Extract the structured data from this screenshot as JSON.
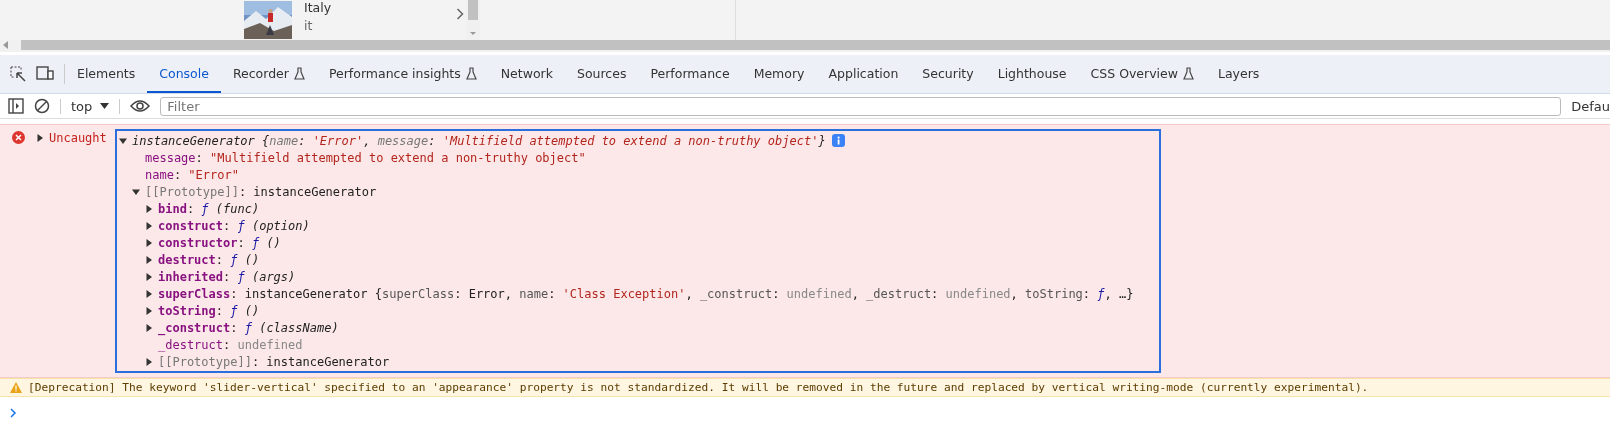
{
  "page_preview": {
    "kind": "picture",
    "title": "Italy",
    "subtitle": "it"
  },
  "tabs": [
    {
      "label": "Elements",
      "selected": false,
      "experimental": false
    },
    {
      "label": "Console",
      "selected": true,
      "experimental": false
    },
    {
      "label": "Recorder",
      "selected": false,
      "experimental": true
    },
    {
      "label": "Performance insights",
      "selected": false,
      "experimental": true
    },
    {
      "label": "Network",
      "selected": false,
      "experimental": false
    },
    {
      "label": "Sources",
      "selected": false,
      "experimental": false
    },
    {
      "label": "Performance",
      "selected": false,
      "experimental": false
    },
    {
      "label": "Memory",
      "selected": false,
      "experimental": false
    },
    {
      "label": "Application",
      "selected": false,
      "experimental": false
    },
    {
      "label": "Security",
      "selected": false,
      "experimental": false
    },
    {
      "label": "Lighthouse",
      "selected": false,
      "experimental": false
    },
    {
      "label": "CSS Overview",
      "selected": false,
      "experimental": true
    },
    {
      "label": "Layers",
      "selected": false,
      "experimental": false
    }
  ],
  "console_toolbar": {
    "context": "top",
    "filter_placeholder": "Filter",
    "levels_label": "Defau"
  },
  "messages": [
    {
      "kind": "error",
      "label": "Uncaught",
      "expanded": false,
      "object": {
        "kind": "node",
        "expanded": true,
        "selected": true,
        "info_badge": true,
        "segments": [
          {
            "text": "instanceGenerator ",
            "kind": "class"
          },
          {
            "text": "{",
            "kind": "preview"
          },
          {
            "text": "name",
            "kind": "preview_key"
          },
          {
            "text": ": ",
            "kind": "preview"
          },
          {
            "text": "'Error'",
            "kind": "preview_string"
          },
          {
            "text": ", ",
            "kind": "preview"
          },
          {
            "text": "message",
            "kind": "preview_key"
          },
          {
            "text": ": ",
            "kind": "preview"
          },
          {
            "text": "'Multifield attempted to extend a non-truthy object'",
            "kind": "preview_string"
          },
          {
            "text": "}",
            "kind": "preview"
          }
        ],
        "children": [
          {
            "kind": "leaf",
            "segments": [
              {
                "text": "message",
                "kind": "key"
              },
              {
                "text": ": ",
                "kind": "plain"
              },
              {
                "text": "\"Multifield attempted to extend a non-truthy object\"",
                "kind": "string"
              }
            ]
          },
          {
            "kind": "leaf",
            "segments": [
              {
                "text": "name",
                "kind": "key"
              },
              {
                "text": ": ",
                "kind": "plain"
              },
              {
                "text": "\"Error\"",
                "kind": "string"
              }
            ]
          },
          {
            "kind": "node",
            "expanded": true,
            "segments": [
              {
                "text": "[[Prototype]]",
                "kind": "internal"
              },
              {
                "text": ": instanceGenerator",
                "kind": "plain"
              }
            ],
            "children": [
              {
                "kind": "node",
                "expanded": false,
                "segments": [
                  {
                    "text": "bind",
                    "kind": "method"
                  },
                  {
                    "text": ": ",
                    "kind": "plain"
                  },
                  {
                    "text": "ƒ",
                    "kind": "func"
                  },
                  {
                    "text": " (func)",
                    "kind": "args"
                  }
                ]
              },
              {
                "kind": "node",
                "expanded": false,
                "segments": [
                  {
                    "text": "construct",
                    "kind": "method"
                  },
                  {
                    "text": ": ",
                    "kind": "plain"
                  },
                  {
                    "text": "ƒ",
                    "kind": "func"
                  },
                  {
                    "text": " (option)",
                    "kind": "args"
                  }
                ]
              },
              {
                "kind": "node",
                "expanded": false,
                "segments": [
                  {
                    "text": "constructor",
                    "kind": "method"
                  },
                  {
                    "text": ": ",
                    "kind": "plain"
                  },
                  {
                    "text": "ƒ",
                    "kind": "func"
                  },
                  {
                    "text": " ()",
                    "kind": "args"
                  }
                ]
              },
              {
                "kind": "node",
                "expanded": false,
                "segments": [
                  {
                    "text": "destruct",
                    "kind": "method"
                  },
                  {
                    "text": ": ",
                    "kind": "plain"
                  },
                  {
                    "text": "ƒ",
                    "kind": "func"
                  },
                  {
                    "text": " ()",
                    "kind": "args"
                  }
                ]
              },
              {
                "kind": "node",
                "expanded": false,
                "segments": [
                  {
                    "text": "inherited",
                    "kind": "method"
                  },
                  {
                    "text": ": ",
                    "kind": "plain"
                  },
                  {
                    "text": "ƒ",
                    "kind": "func"
                  },
                  {
                    "text": " (args)",
                    "kind": "args"
                  }
                ]
              },
              {
                "kind": "node",
                "expanded": false,
                "segments": [
                  {
                    "text": "superClass",
                    "kind": "method"
                  },
                  {
                    "text": ": instanceGenerator {",
                    "kind": "plain"
                  },
                  {
                    "text": "superClass",
                    "kind": "inner_key"
                  },
                  {
                    "text": ": Error, ",
                    "kind": "plain"
                  },
                  {
                    "text": "name",
                    "kind": "inner_key"
                  },
                  {
                    "text": ": ",
                    "kind": "plain"
                  },
                  {
                    "text": "'Class Exception'",
                    "kind": "string"
                  },
                  {
                    "text": ", ",
                    "kind": "plain"
                  },
                  {
                    "text": "_construct",
                    "kind": "inner_key"
                  },
                  {
                    "text": ": ",
                    "kind": "plain"
                  },
                  {
                    "text": "undefined",
                    "kind": "undefined"
                  },
                  {
                    "text": ", ",
                    "kind": "plain"
                  },
                  {
                    "text": "_destruct",
                    "kind": "inner_key"
                  },
                  {
                    "text": ": ",
                    "kind": "plain"
                  },
                  {
                    "text": "undefined",
                    "kind": "undefined"
                  },
                  {
                    "text": ", ",
                    "kind": "plain"
                  },
                  {
                    "text": "toString",
                    "kind": "inner_key"
                  },
                  {
                    "text": ": ",
                    "kind": "plain"
                  },
                  {
                    "text": "ƒ",
                    "kind": "func"
                  },
                  {
                    "text": ", …}",
                    "kind": "plain"
                  }
                ]
              },
              {
                "kind": "node",
                "expanded": false,
                "segments": [
                  {
                    "text": "toString",
                    "kind": "method"
                  },
                  {
                    "text": ": ",
                    "kind": "plain"
                  },
                  {
                    "text": "ƒ",
                    "kind": "func"
                  },
                  {
                    "text": " ()",
                    "kind": "args"
                  }
                ]
              },
              {
                "kind": "node",
                "expanded": false,
                "segments": [
                  {
                    "text": "_construct",
                    "kind": "method"
                  },
                  {
                    "text": ": ",
                    "kind": "plain"
                  },
                  {
                    "text": "ƒ",
                    "kind": "func"
                  },
                  {
                    "text": " (className)",
                    "kind": "args"
                  }
                ]
              },
              {
                "kind": "leaf",
                "segments": [
                  {
                    "text": "_destruct",
                    "kind": "key"
                  },
                  {
                    "text": ": ",
                    "kind": "plain"
                  },
                  {
                    "text": "undefined",
                    "kind": "undefined"
                  }
                ]
              },
              {
                "kind": "node",
                "expanded": false,
                "segments": [
                  {
                    "text": "[[Prototype]]",
                    "kind": "internal"
                  },
                  {
                    "text": ": instanceGenerator",
                    "kind": "plain"
                  }
                ]
              }
            ]
          }
        ]
      }
    },
    {
      "kind": "warning",
      "text": "[Deprecation] The keyword 'slider-vertical' specified to an 'appearance' property is not standardized. It will be removed in the future and replaced by vertical writing-mode (currently experimental)."
    }
  ]
}
